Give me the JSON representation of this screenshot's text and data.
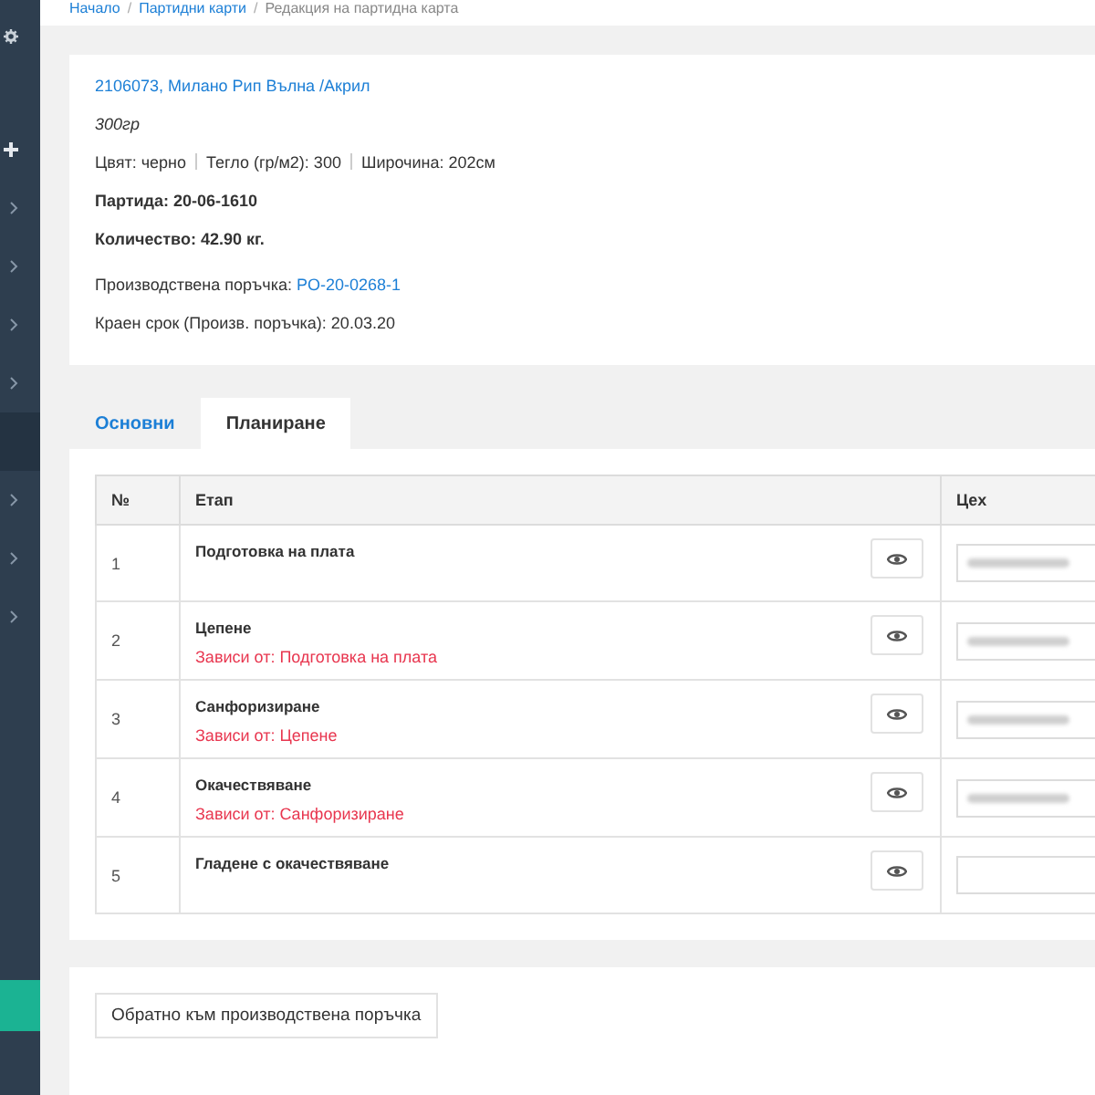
{
  "breadcrumb": [
    "Начало",
    "Партидни карти",
    "Редакция на партидна карта"
  ],
  "breadcrumb_separator": "/",
  "sidebar": {
    "items": [
      {
        "kind": "gear",
        "selected": false
      },
      {
        "kind": "plus",
        "selected": false
      },
      {
        "kind": "chevron",
        "selected": false
      },
      {
        "kind": "chevron",
        "selected": false
      },
      {
        "kind": "chevron",
        "selected": false
      },
      {
        "kind": "chevron",
        "selected": false
      },
      {
        "kind": "blank",
        "selected": true
      },
      {
        "kind": "chevron",
        "selected": false
      },
      {
        "kind": "chevron",
        "selected": false
      },
      {
        "kind": "chevron",
        "selected": false
      }
    ]
  },
  "summary": {
    "title": "2106073, Милано Рип Вълна /Акрил",
    "subtitle": "300гр",
    "specs": [
      "Цвят: черно",
      "Тегло (гр/м2): 300",
      "Широчина: 202см"
    ],
    "batch": "Партида: 20-06-1610",
    "quantity": "Количество: 42.90 кг.",
    "order_label": "Производствена поръчка: ",
    "order_link": "PO-20-0268-1",
    "deadline": "Краен срок (Произв. поръчка): 20.03.20"
  },
  "tabs": [
    {
      "label": "Основни",
      "selected": false
    },
    {
      "label": "Планиране",
      "selected": true
    }
  ],
  "table": {
    "columns": [
      "№",
      "Етап",
      "Цех"
    ],
    "rows": [
      {
        "number": "1",
        "stage": "Подготовка на плата",
        "workshop_filled": true
      },
      {
        "number": "2",
        "stage": "Цепене",
        "depends": "Зависи от: Подготовка на плата",
        "workshop_filled": true
      },
      {
        "number": "3",
        "stage": "Санфоризиране",
        "depends": "Зависи от: Цепене",
        "workshop_filled": true
      },
      {
        "number": "4",
        "stage": "Окачествяване",
        "depends": "Зависи от: Санфоризиране",
        "workshop_filled": true
      },
      {
        "number": "5",
        "stage": "Гладене с окачествяване",
        "workshop_filled": false
      }
    ]
  },
  "back_button": "Обратно към производствена поръчка"
}
